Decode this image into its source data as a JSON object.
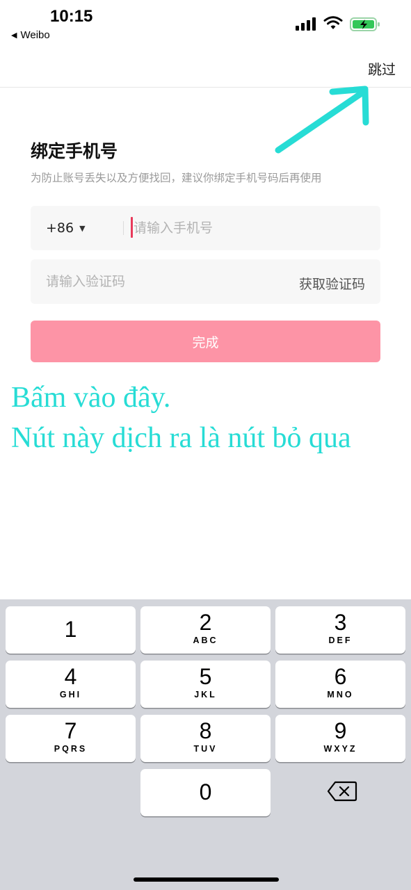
{
  "status_bar": {
    "time": "10:15",
    "back_app": "Weibo",
    "back_icon": "back-triangle-icon",
    "battery_state": "charging",
    "battery_color": "#34c759"
  },
  "nav": {
    "skip_label": "跳过"
  },
  "form": {
    "title": "绑定手机号",
    "subtitle": "为防止账号丢失以及方便找回，建议你绑定手机号码后再使用",
    "country_code": "+86",
    "phone_placeholder": "请输入手机号",
    "code_placeholder": "请输入验证码",
    "get_code_label": "获取验证码",
    "done_label": "完成",
    "done_color": "#fd94a6"
  },
  "annotation": {
    "line1": "Bấm vào đây.",
    "line2": "Nút này dịch ra là nút bỏ qua",
    "color": "#27dcd5",
    "arrow_icon": "arrow-up-right-icon"
  },
  "keyboard": {
    "keys": [
      {
        "digit": "1",
        "letters": ""
      },
      {
        "digit": "2",
        "letters": "ABC"
      },
      {
        "digit": "3",
        "letters": "DEF"
      },
      {
        "digit": "4",
        "letters": "GHI"
      },
      {
        "digit": "5",
        "letters": "JKL"
      },
      {
        "digit": "6",
        "letters": "MNO"
      },
      {
        "digit": "7",
        "letters": "PQRS"
      },
      {
        "digit": "8",
        "letters": "TUV"
      },
      {
        "digit": "9",
        "letters": "WXYZ"
      },
      {
        "digit": "0",
        "letters": ""
      }
    ],
    "delete_icon": "backspace-icon"
  }
}
